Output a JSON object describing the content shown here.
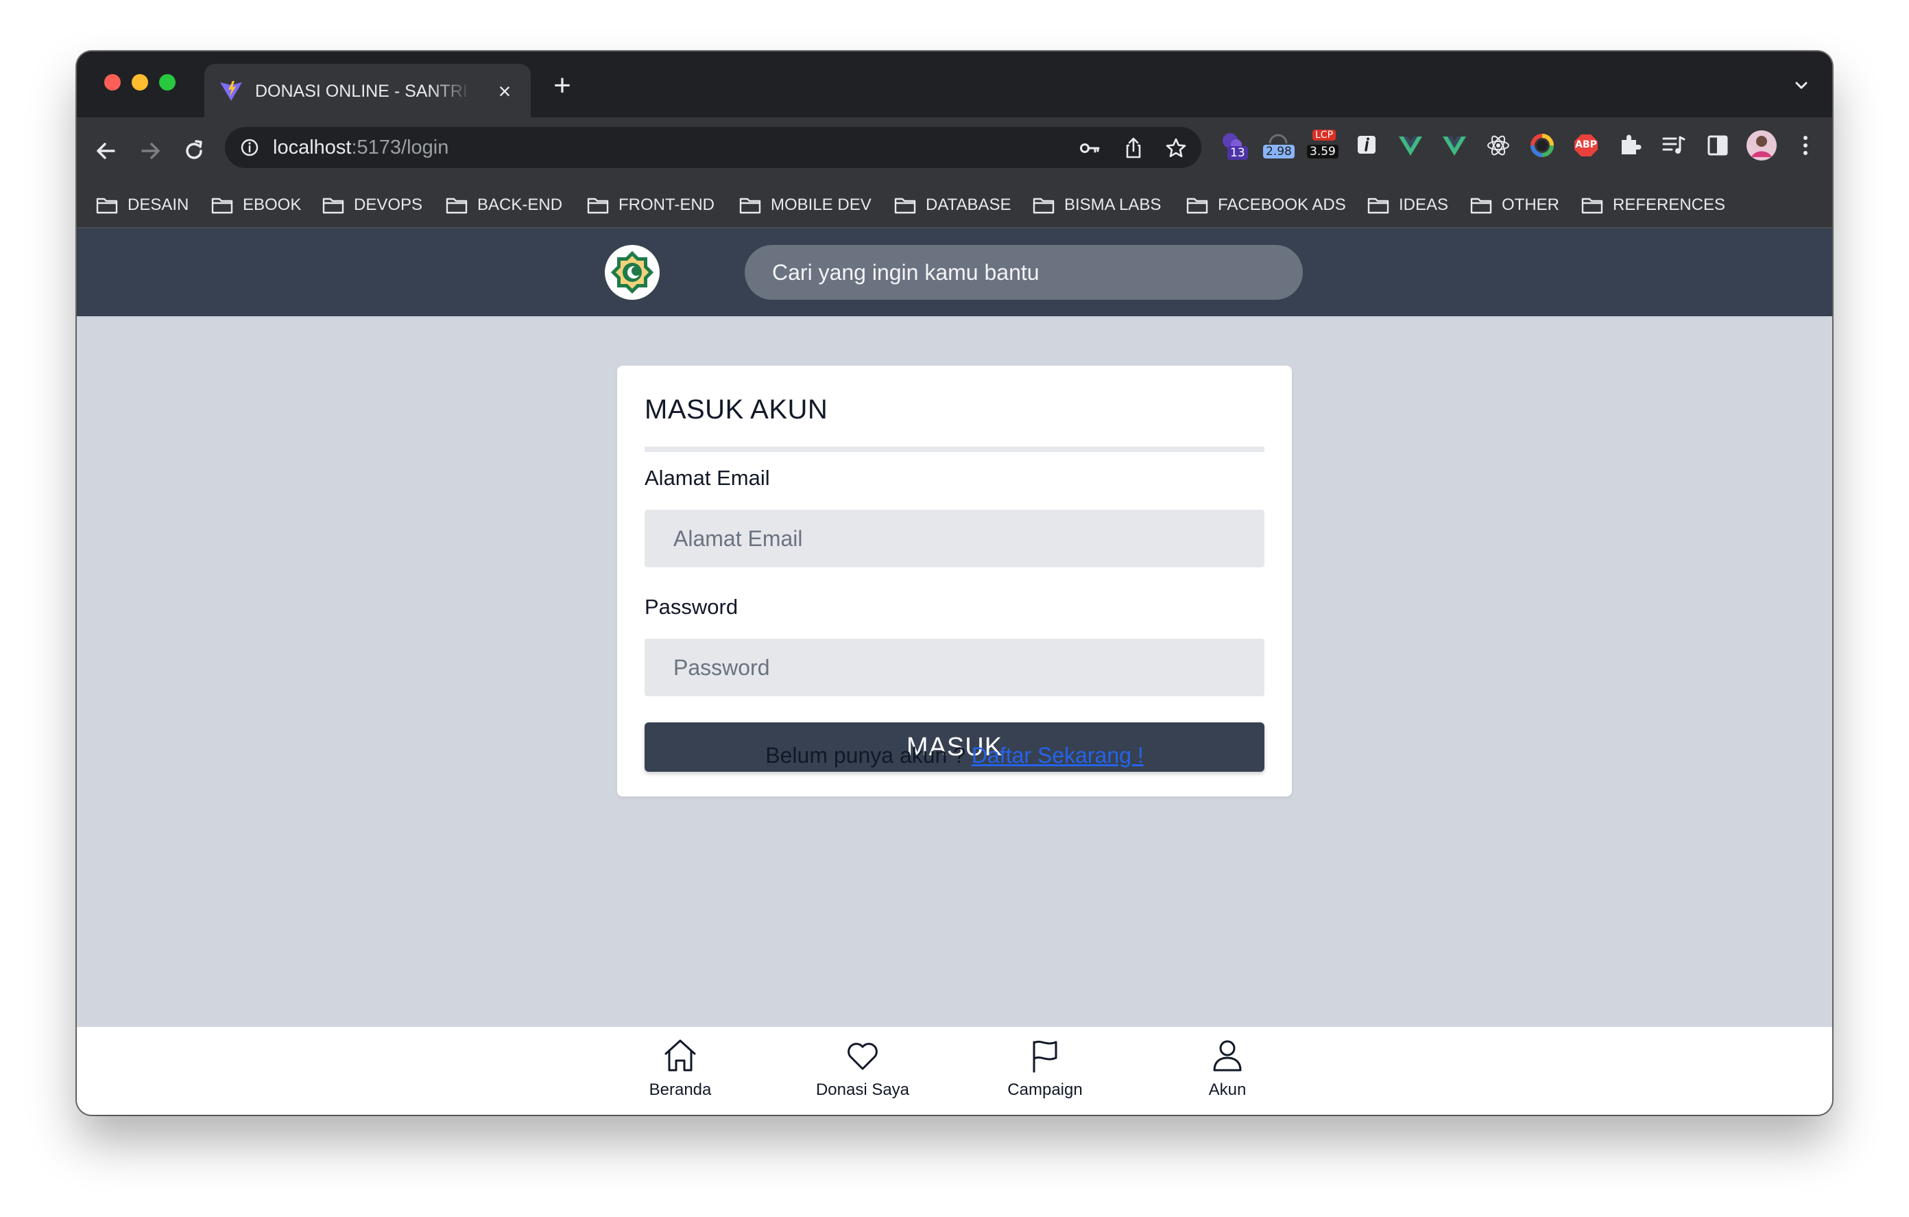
{
  "browser": {
    "tab": {
      "title": "DONASI ONLINE - SANTRIKODING"
    },
    "url": {
      "host": "localhost",
      "path": ":5173/login"
    },
    "extensions": [
      {
        "name": "puzzle-extension-icon",
        "badge": "13"
      },
      {
        "name": "web-vitals-icon",
        "badge": "2.98"
      },
      {
        "name": "lcp-icon",
        "label": "LCP",
        "badge": "3.59"
      },
      {
        "name": "info-extension-icon"
      },
      {
        "name": "vue-devtools-icon"
      },
      {
        "name": "vue-devtools-icon"
      },
      {
        "name": "react-devtools-icon"
      },
      {
        "name": "color-picker-icon"
      },
      {
        "name": "adblock-plus-icon",
        "label": "ABP"
      },
      {
        "name": "extensions-icon"
      },
      {
        "name": "reading-list-icon"
      },
      {
        "name": "side-panel-icon"
      },
      {
        "name": "profile-avatar"
      },
      {
        "name": "more-menu-icon"
      }
    ],
    "bookmarks": [
      "DESAIN",
      "EBOOK",
      "DEVOPS",
      "BACK-END",
      "FRONT-END",
      "MOBILE DEV",
      "DATABASE",
      "BISMA LABS",
      "FACEBOOK ADS",
      "IDEAS",
      "OTHER",
      "REFERENCES"
    ]
  },
  "header": {
    "search_placeholder": "Cari yang ingin kamu bantu"
  },
  "login": {
    "title": "MASUK AKUN",
    "email_label": "Alamat Email",
    "email_placeholder": "Alamat Email",
    "password_label": "Password",
    "password_placeholder": "Password",
    "submit_label": "MASUK"
  },
  "register": {
    "prompt": "Belum punya akun ? ",
    "link": "Daftar Sekarang !"
  },
  "bottom_nav": [
    {
      "label": "Beranda",
      "icon": "home-icon"
    },
    {
      "label": "Donasi Saya",
      "icon": "heart-icon"
    },
    {
      "label": "Campaign",
      "icon": "flag-icon"
    },
    {
      "label": "Akun",
      "icon": "user-icon"
    }
  ],
  "colors": {
    "header_bg": "#374151",
    "page_bg": "#d1d5dd",
    "search_bg": "#6b7280",
    "button_bg": "#374151",
    "input_bg": "#e5e7eb",
    "link": "#2563eb",
    "traffic_red": "#ff5f57",
    "traffic_yellow": "#febc2e",
    "traffic_green": "#28c840"
  }
}
